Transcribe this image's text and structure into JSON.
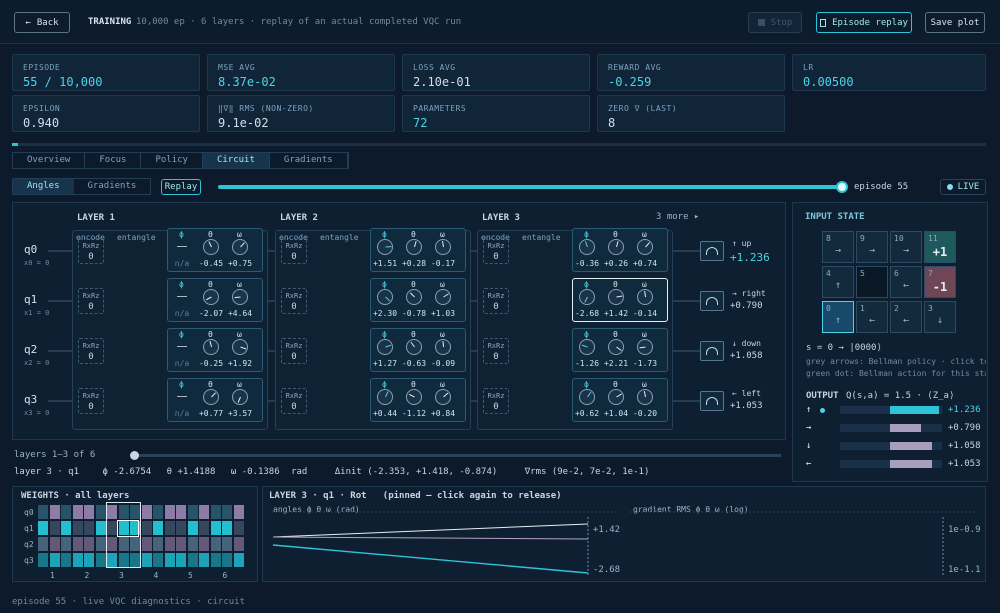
{
  "header": {
    "back_label": "Back",
    "section": "TRAINING",
    "subtitle": "10,000 ep · 6 layers · replay of an actual completed VQC run",
    "stop_label": "Stop",
    "episode_replay_label": "Episode replay",
    "save_plot_label": "Save plot"
  },
  "metrics": [
    {
      "key": "EPISODE",
      "value": "55 / 10,000",
      "accent": true
    },
    {
      "key": "MSE AVG",
      "value": "8.37e-02",
      "accent": true
    },
    {
      "key": "LOSS AVG",
      "value": "2.10e-01",
      "accent": false
    },
    {
      "key": "REWARD AVG",
      "value": "-0.259",
      "accent": true
    },
    {
      "key": "LR",
      "value": "0.00500",
      "accent": true
    },
    {
      "key": "EPSILON",
      "value": "0.940",
      "accent": false
    },
    {
      "key": "‖∇‖ RMS (NON-ZERO)",
      "value": "9.1e-02",
      "accent": false
    },
    {
      "key": "PARAMETERS",
      "value": "72",
      "accent": true
    },
    {
      "key": "ZERO ∇ (LAST)",
      "value": "8",
      "accent": false
    }
  ],
  "tabs": [
    "Overview",
    "Focus",
    "Policy",
    "Circuit",
    "Gradients"
  ],
  "active_tab": "Circuit",
  "subtabs": [
    "Angles",
    "Gradients"
  ],
  "replay_label": "Replay",
  "episode_label": "episode 55",
  "live_label": "LIVE",
  "replay_progress": 1.0,
  "layers": [
    {
      "title": "LAYER 1"
    },
    {
      "title": "LAYER 2"
    },
    {
      "title": "LAYER 3"
    }
  ],
  "more_label": "3 more ▸",
  "col_encode": "encode",
  "col_entangle": "entangle",
  "rot_header": "Rot(ϕ θ ω)",
  "enc_label": "RxRz",
  "qubits": [
    {
      "name": "q0",
      "init": "x0 = 0",
      "enc": "0",
      "rot": [
        [
          "—",
          "-0.45",
          "+0.75"
        ],
        [
          "+1.51",
          "+0.28",
          "-0.17"
        ],
        [
          "-0.36",
          "+0.26",
          "+0.74"
        ]
      ],
      "action_arrow": "↑ up",
      "action_value": "+1.236",
      "best": true
    },
    {
      "name": "q1",
      "init": "x1 = 0",
      "enc": "0",
      "rot": [
        [
          "—",
          "-2.07",
          "+4.64"
        ],
        [
          "+2.30",
          "-0.78",
          "+1.03"
        ],
        [
          "-2.68",
          "+1.42",
          "-0.14"
        ]
      ],
      "action_arrow": "→ right",
      "action_value": "+0.790",
      "best": false
    },
    {
      "name": "q2",
      "init": "x2 = 0",
      "enc": "0",
      "rot": [
        [
          "—",
          "-0.25",
          "+1.92"
        ],
        [
          "+1.27",
          "-0.63",
          "-0.09"
        ],
        [
          "-1.26",
          "+2.21",
          "-1.73"
        ]
      ],
      "action_arrow": "↓ down",
      "action_value": "+1.058",
      "best": false
    },
    {
      "name": "q3",
      "init": "x3 = 0",
      "enc": "0",
      "rot": [
        [
          "—",
          "+0.77",
          "+3.57"
        ],
        [
          "+0.44",
          "-1.12",
          "+0.84"
        ],
        [
          "+0.62",
          "+1.04",
          "-0.20"
        ]
      ],
      "action_arrow": "← left",
      "action_value": "+1.053",
      "best": false
    }
  ],
  "na_label": "n/a",
  "layers_range": "layers 1–3 of 6",
  "status_line": {
    "layer": "layer 3 · q1",
    "phi": "ϕ -2.6754",
    "theta": "θ +1.4188",
    "omega": "ω -0.1386",
    "unit": "rad",
    "delta": "Δinit (-2.353, +1.418, -0.874)",
    "grad": "∇rms (9e-2, 7e-2, 1e-1)"
  },
  "input_state": {
    "title": "INPUT STATE",
    "cells": [
      {
        "n": "8",
        "a": "→"
      },
      {
        "n": "9",
        "a": "→"
      },
      {
        "n": "10",
        "a": "→"
      },
      {
        "n": "11",
        "a": "+1",
        "goal": true
      },
      {
        "n": "4",
        "a": "↑"
      },
      {
        "n": "5",
        "a": "",
        "wall": true
      },
      {
        "n": "6",
        "a": "←"
      },
      {
        "n": "7",
        "a": "-1",
        "pit": true
      },
      {
        "n": "0",
        "a": "↑",
        "agent": true
      },
      {
        "n": "1",
        "a": "←"
      },
      {
        "n": "2",
        "a": "←"
      },
      {
        "n": "3",
        "a": "↓"
      }
    ],
    "state_line": "s = 0  →  |0000⟩",
    "hint1": "grey arrows: Bellman policy · click to",
    "hint2": "green dot: Bellman action for this stat",
    "output_title": "OUTPUT",
    "output_formula": "Q(s,a) = 1.5 · ⟨Z_a⟩",
    "outputs": [
      {
        "arrow": "↑",
        "value": "+1.236",
        "frac": 0.82,
        "best": true
      },
      {
        "arrow": "→",
        "value": "+0.790",
        "frac": 0.52,
        "best": false
      },
      {
        "arrow": "↓",
        "value": "+1.058",
        "frac": 0.7,
        "best": false
      },
      {
        "arrow": "←",
        "value": "+1.053",
        "frac": 0.7,
        "best": false
      }
    ]
  },
  "weights": {
    "title": "WEIGHTS · all layers",
    "rows": [
      "q0",
      "q1",
      "q2",
      "q3"
    ],
    "cols": [
      "1",
      "2",
      "3",
      "4",
      "5",
      "6"
    ]
  },
  "detail": {
    "title": "LAYER 3 · q1 · Rot   (pinned — click again to release)",
    "angles_label": "angles ϕ θ ω  (rad)",
    "angle_top": "+1.42",
    "angle_bottom": "-2.68",
    "grad_label": "gradient RMS ϕ θ ω  (log)",
    "grad_top": "1e-0.9",
    "grad_bottom": "1e-1.1"
  },
  "footer": "episode 55 · live VQC diagnostics · circuit",
  "colors": {
    "accent": "#2fc3d8",
    "bg": "#0c1a2b",
    "panel": "#112538",
    "pit": "#6e4656",
    "goal": "#1e5a5c"
  }
}
